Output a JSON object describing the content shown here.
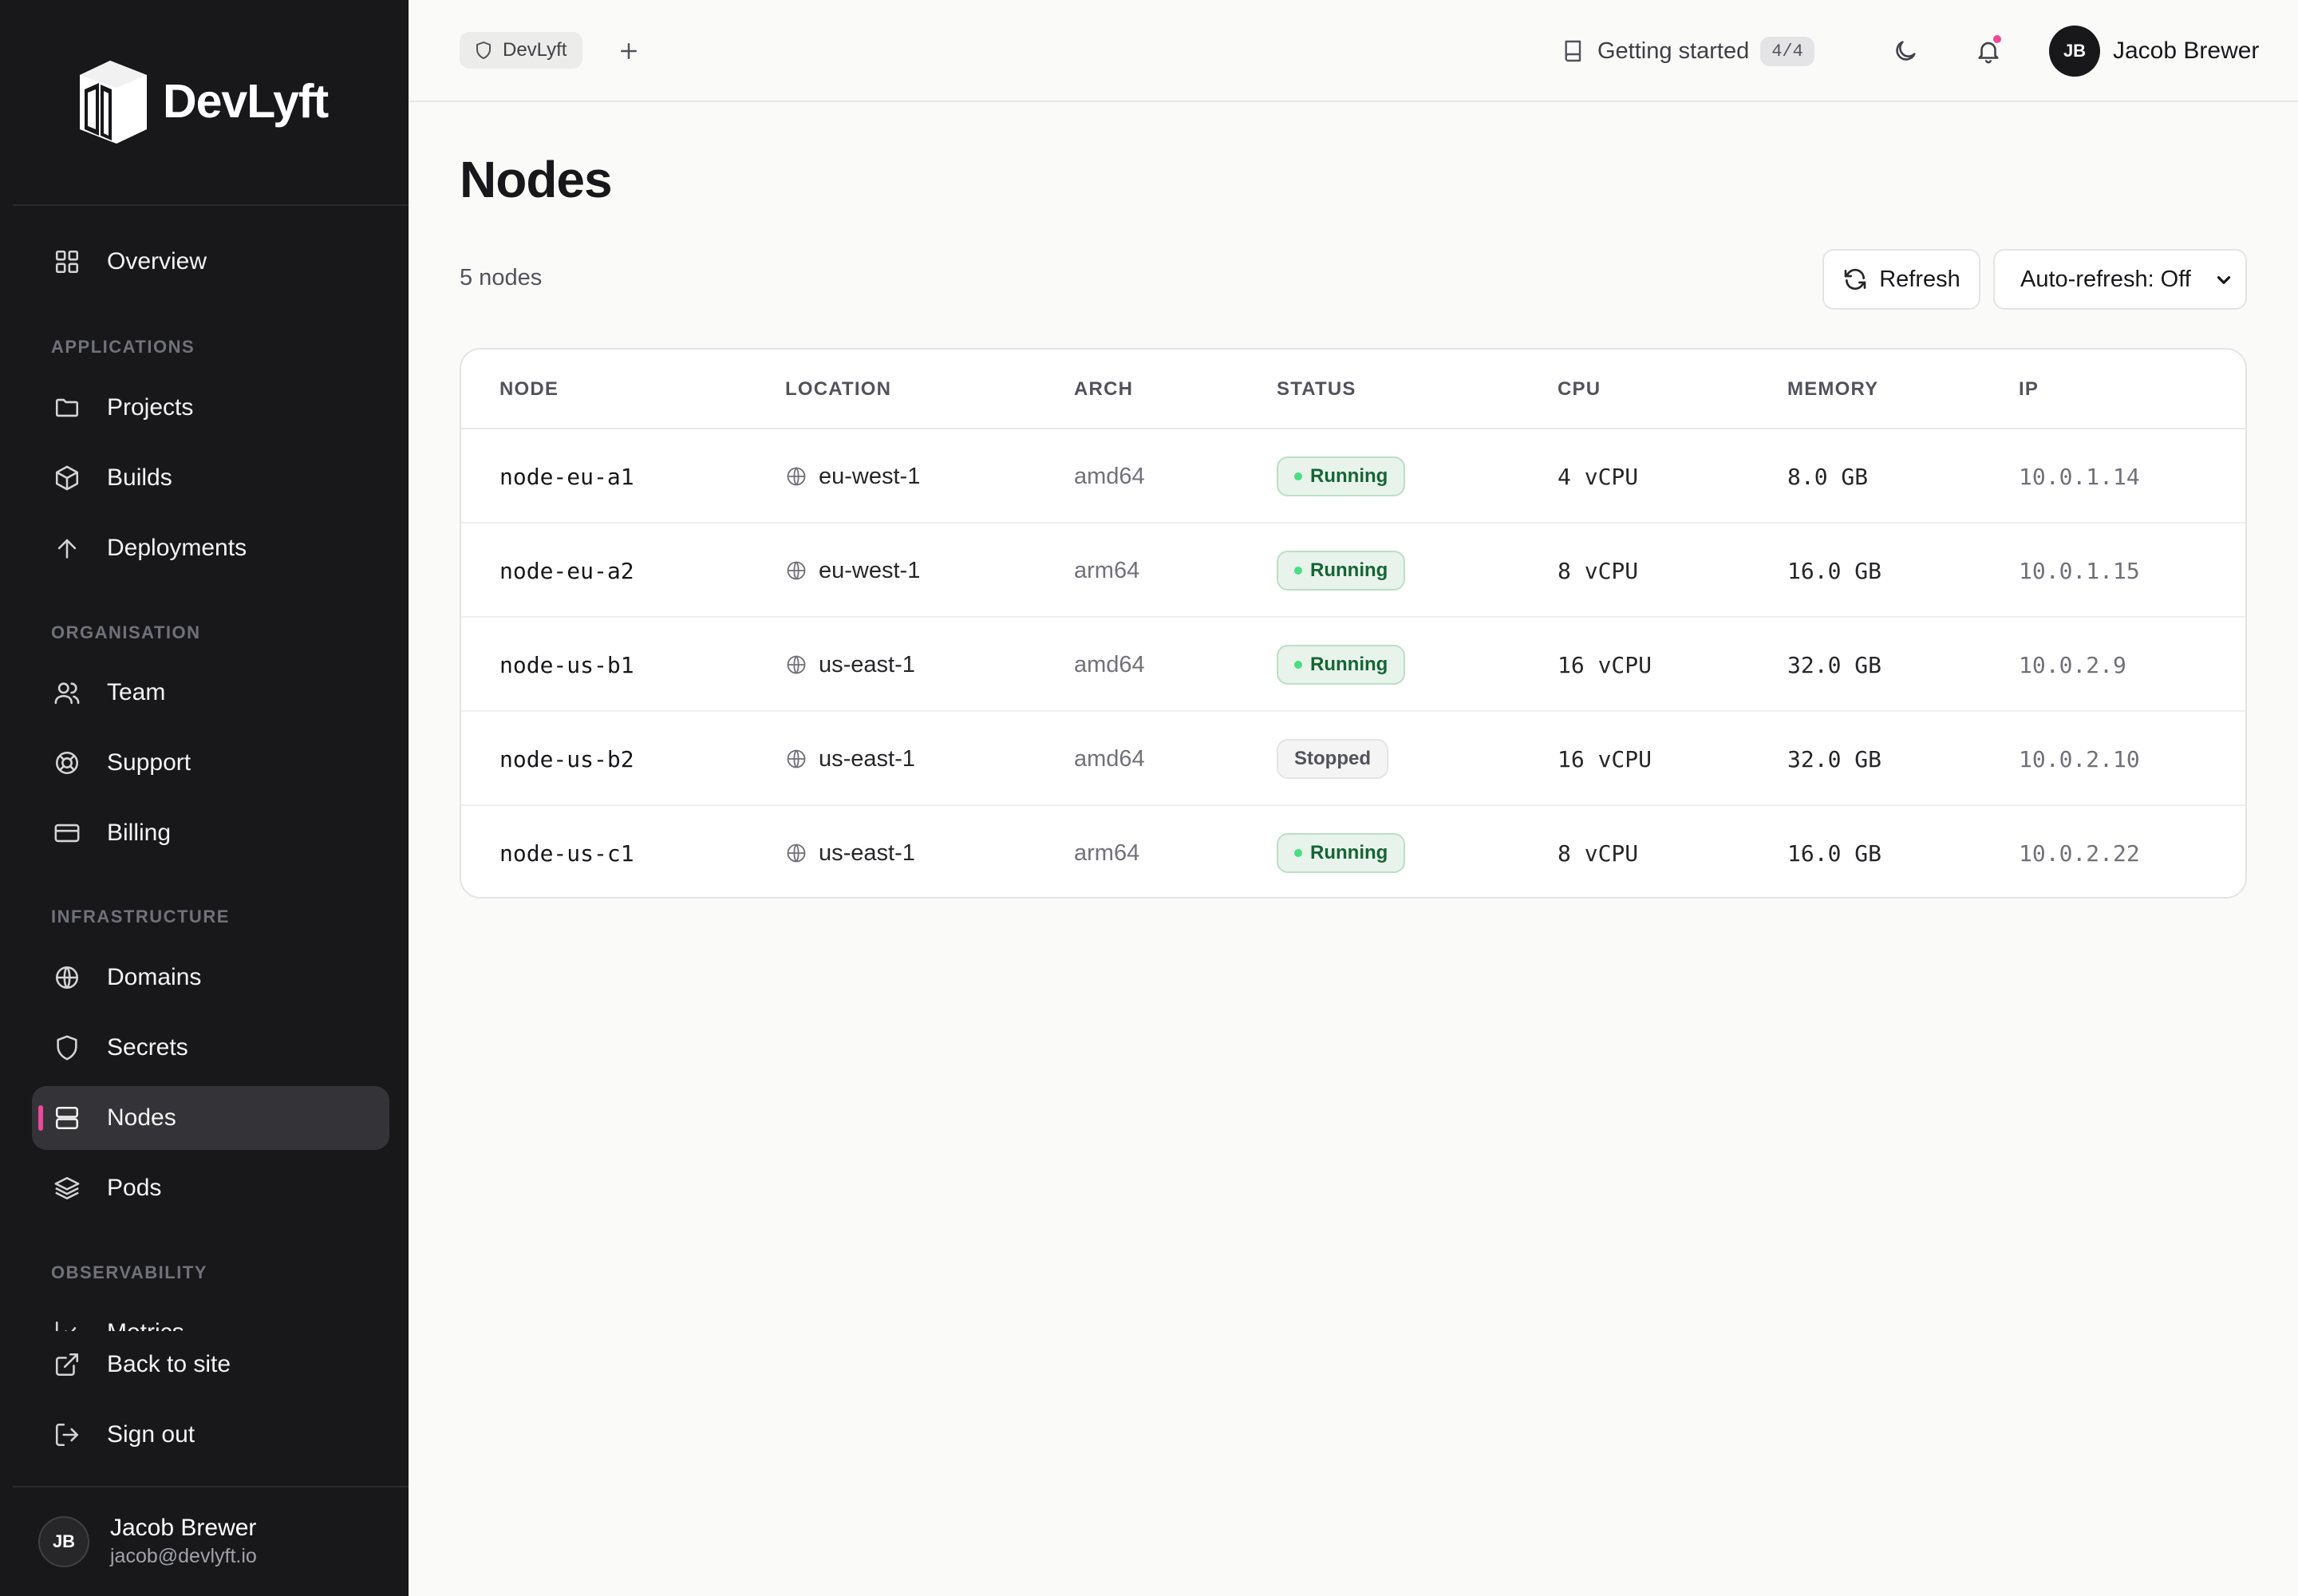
{
  "brand": {
    "name": "DevLyft"
  },
  "sidebar": {
    "overview": "Overview",
    "sections": [
      {
        "label": "APPLICATIONS",
        "items": [
          "Projects",
          "Builds",
          "Deployments"
        ]
      },
      {
        "label": "ORGANISATION",
        "items": [
          "Team",
          "Support",
          "Billing"
        ]
      },
      {
        "label": "INFRASTRUCTURE",
        "items": [
          "Domains",
          "Secrets",
          "Nodes",
          "Pods"
        ]
      },
      {
        "label": "OBSERVABILITY",
        "items": [
          "Metrics"
        ]
      }
    ],
    "active_item": "Nodes",
    "back_to_site": "Back to site",
    "sign_out": "Sign out",
    "user": {
      "initials": "JB",
      "name": "Jacob Brewer",
      "email": "jacob@devlyft.io"
    }
  },
  "topbar": {
    "project_chip": "DevLyft",
    "getting_started": "Getting started",
    "getting_started_progress": "4/4",
    "has_notification": true,
    "user": {
      "initials": "JB",
      "name": "Jacob Brewer"
    }
  },
  "main": {
    "title": "Nodes",
    "count_text": "5 nodes",
    "refresh_label": "Refresh",
    "auto_refresh_value": "Auto-refresh: Off",
    "table": {
      "headers": [
        "NODE",
        "LOCATION",
        "ARCH",
        "STATUS",
        "CPU",
        "MEMORY",
        "IP"
      ],
      "rows": [
        {
          "node": "node-eu-a1",
          "location": "eu-west-1",
          "arch": "amd64",
          "status": "Running",
          "cpu": "4 vCPU",
          "memory": "8.0 GB",
          "ip": "10.0.1.14"
        },
        {
          "node": "node-eu-a2",
          "location": "eu-west-1",
          "arch": "arm64",
          "status": "Running",
          "cpu": "8 vCPU",
          "memory": "16.0 GB",
          "ip": "10.0.1.15"
        },
        {
          "node": "node-us-b1",
          "location": "us-east-1",
          "arch": "amd64",
          "status": "Running",
          "cpu": "16 vCPU",
          "memory": "32.0 GB",
          "ip": "10.0.2.9"
        },
        {
          "node": "node-us-b2",
          "location": "us-east-1",
          "arch": "amd64",
          "status": "Stopped",
          "cpu": "16 vCPU",
          "memory": "32.0 GB",
          "ip": "10.0.2.10"
        },
        {
          "node": "node-us-c1",
          "location": "us-east-1",
          "arch": "arm64",
          "status": "Running",
          "cpu": "8 vCPU",
          "memory": "16.0 GB",
          "ip": "10.0.2.22"
        }
      ]
    }
  },
  "colors": {
    "sidebar_bg": "#18181b",
    "accent": "#ec4899",
    "running_text": "#166534",
    "running_bg": "#e8f3ec"
  },
  "icons": {
    "overview": "grid-icon",
    "projects": "folder-icon",
    "builds": "box-icon",
    "deployments": "arrow-up-icon",
    "team": "users-icon",
    "support": "lifebuoy-icon",
    "billing": "credit-card-icon",
    "domains": "globe-icon",
    "secrets": "shield-icon",
    "nodes": "server-icon",
    "pods": "layers-icon",
    "metrics": "chart-icon",
    "back_to_site": "external-link-icon",
    "sign_out": "log-out-icon"
  }
}
